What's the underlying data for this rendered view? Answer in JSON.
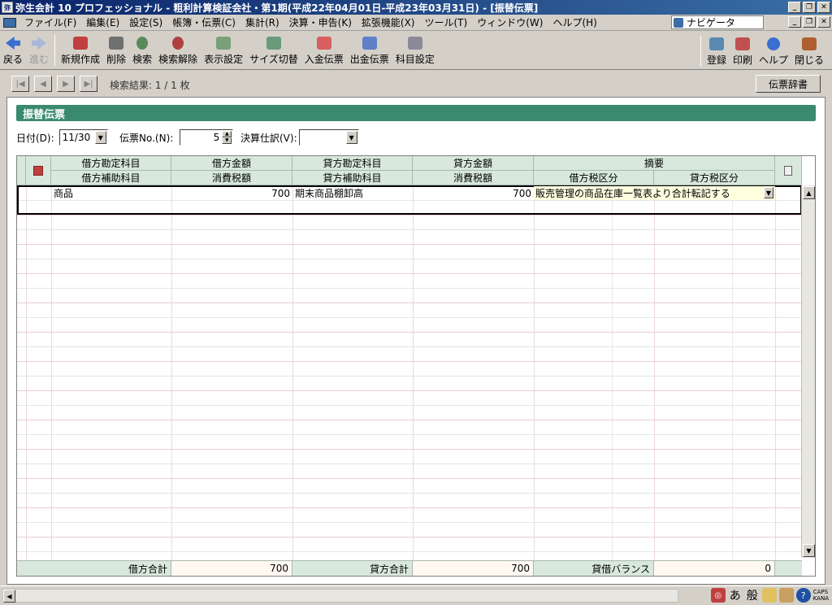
{
  "window": {
    "title": "弥生会計 10 プロフェッショナル - 粗利計算検証会社・第1期(平成22年04月01日-平成23年03月31日) - [振替伝票]",
    "icon_text": "弥"
  },
  "menu": {
    "items": [
      "ファイル(F)",
      "編集(E)",
      "設定(S)",
      "帳簿・伝票(C)",
      "集計(R)",
      "決算・申告(K)",
      "拡張機能(X)",
      "ツール(T)",
      "ウィンドウ(W)",
      "ヘルプ(H)"
    ],
    "navigator_label": "ナビゲータ"
  },
  "toolbar": {
    "back": "戻る",
    "forward": "進む",
    "new": "新規作成",
    "delete": "削除",
    "search": "検索",
    "search_clear": "検索解除",
    "display_settings": "表示設定",
    "size_toggle": "サイズ切替",
    "receipt_slip": "入金伝票",
    "payment_slip": "出金伝票",
    "account_settings": "科目設定",
    "register": "登録",
    "print": "印刷",
    "help": "ヘルプ",
    "close": "閉じる"
  },
  "nav": {
    "search_result": "検索結果: 1 / 1 枚",
    "dictionary_button": "伝票辞書"
  },
  "form": {
    "section_title": "振替伝票",
    "date_label": "日付(D):",
    "date_value": "11/30",
    "slip_no_label": "伝票No.(N):",
    "slip_no_value": "5",
    "closing_label": "決算仕訳(V):",
    "closing_value": ""
  },
  "grid": {
    "headers_top": [
      "借方勘定科目",
      "借方金額",
      "貸方勘定科目",
      "貸方金額",
      "摘要"
    ],
    "headers_bottom": [
      "借方補助科目",
      "消費税額",
      "貸方補助科目",
      "消費税額",
      "借方税区分",
      "貸方税区分"
    ],
    "rows": [
      {
        "debit_account": "商品",
        "debit_amount": "700",
        "credit_account": "期末商品棚卸高",
        "credit_amount": "700",
        "memo": "販売管理の商品在庫一覧表より合計転記する"
      }
    ],
    "footer": {
      "debit_total_label": "借方合計",
      "debit_total": "700",
      "credit_total_label": "貸方合計",
      "credit_total": "700",
      "balance_label": "貸借バランス",
      "balance": "0"
    }
  },
  "statusbar": {
    "ime_hiragana": "あ",
    "ime_mode": "般",
    "caps": "CAPS",
    "kana": "KANA"
  },
  "colors": {
    "title_bar": "#0a246a",
    "section_header": "#3a8a70",
    "grid_header": "#d8e8dc"
  }
}
